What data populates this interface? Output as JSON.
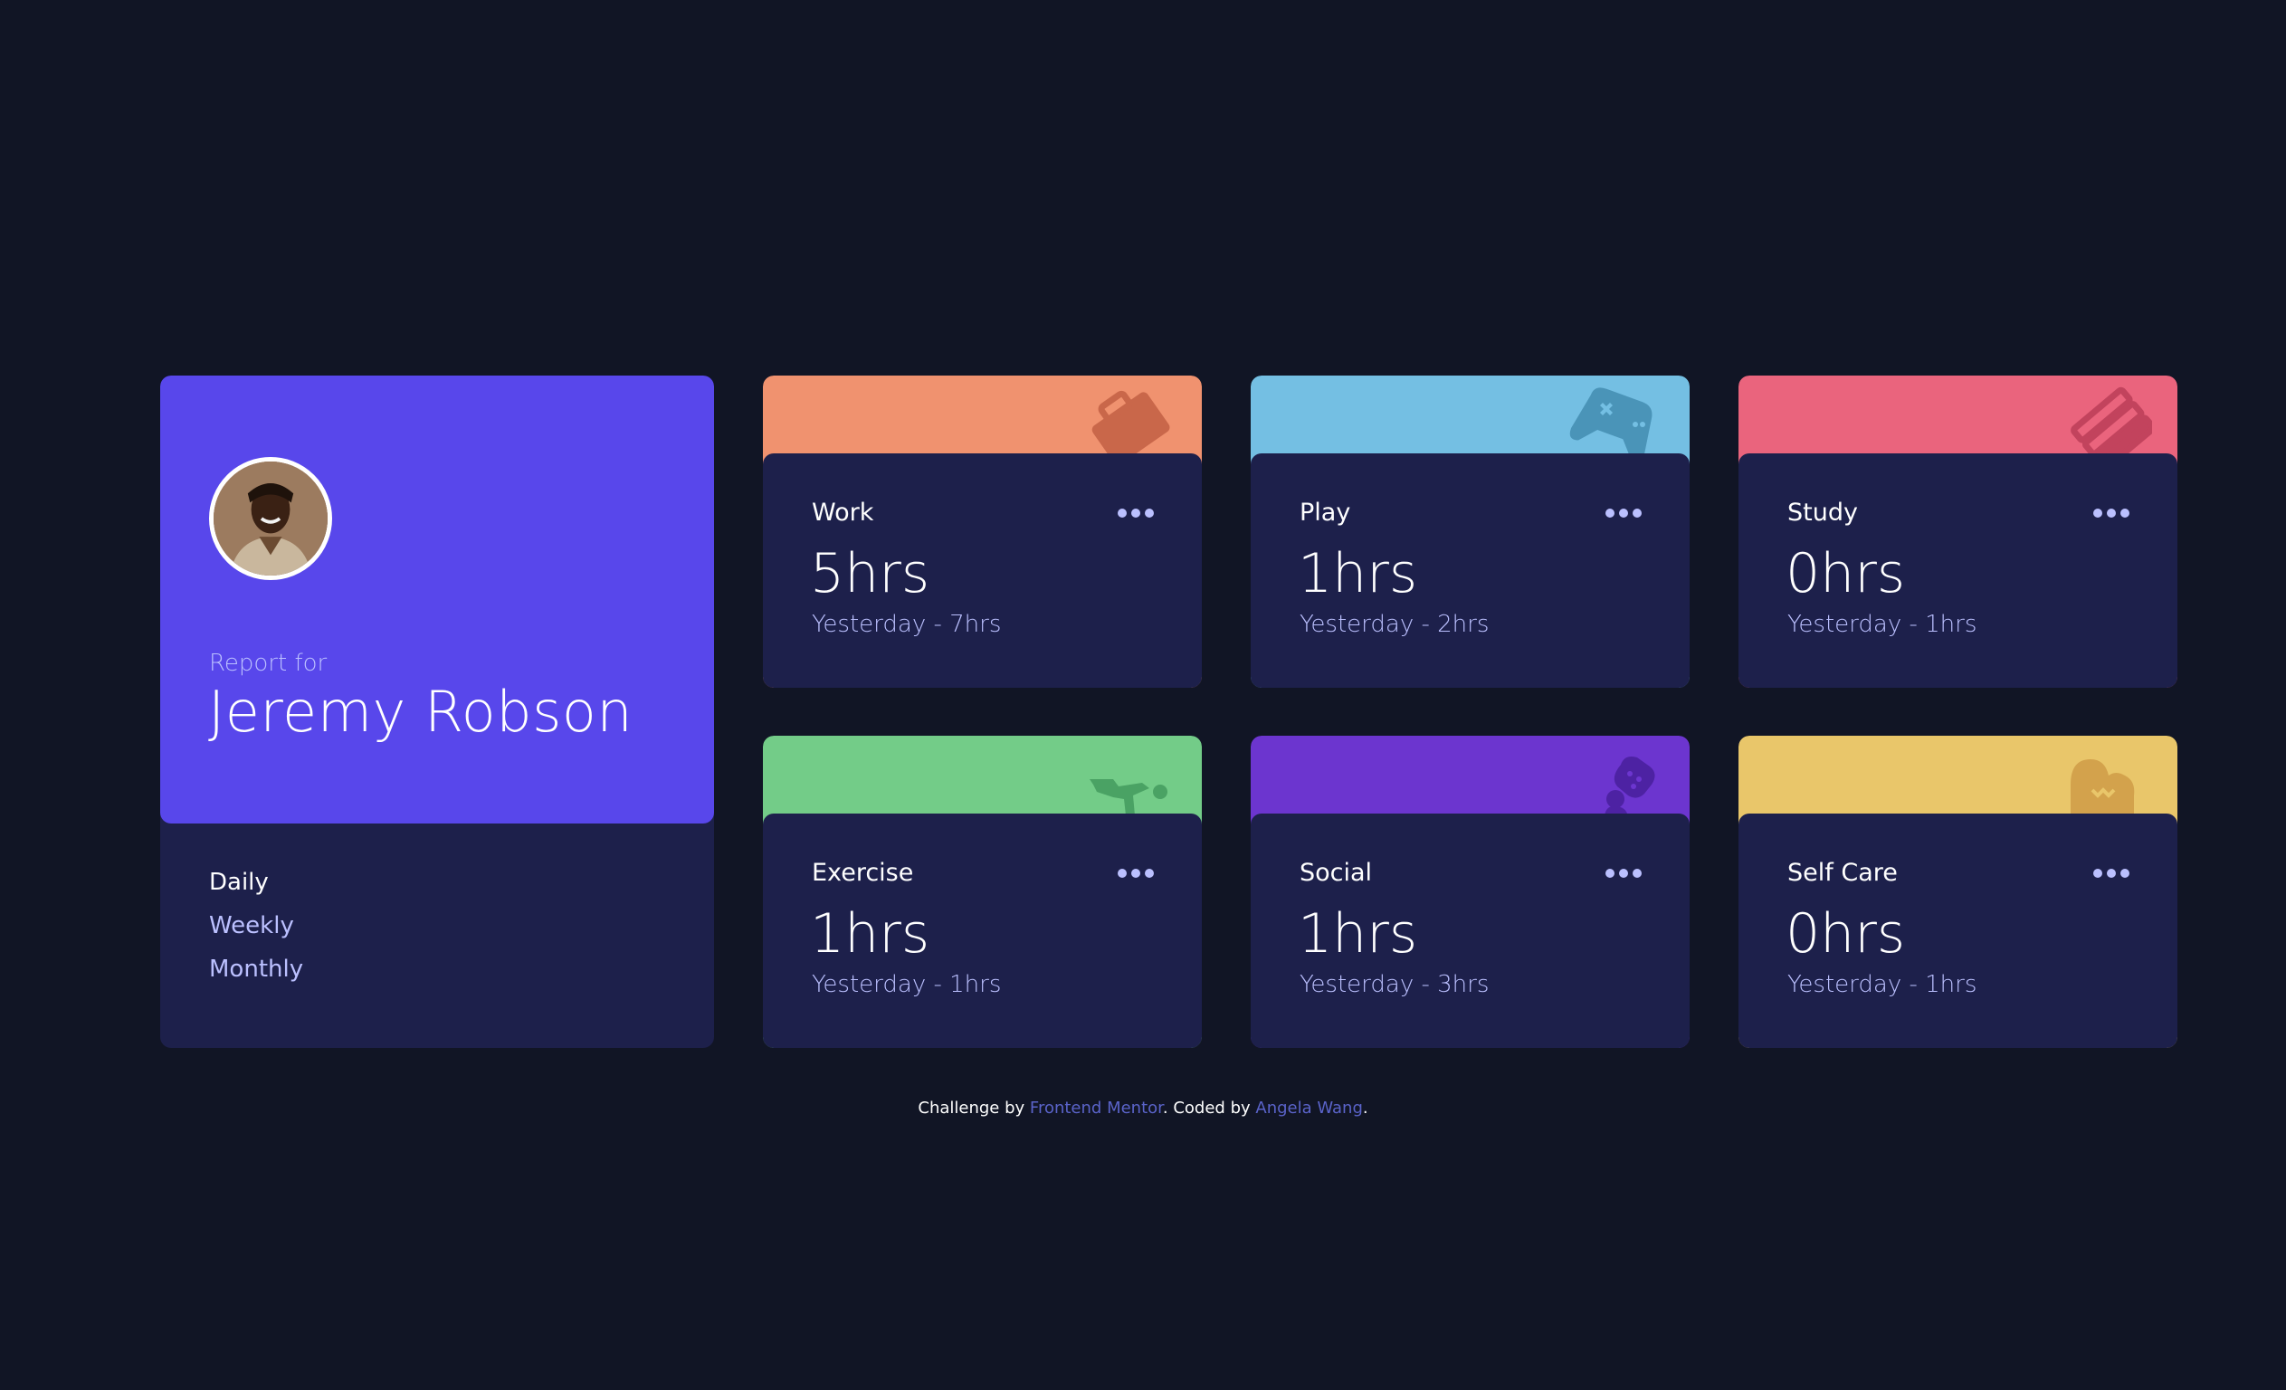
{
  "profile": {
    "report_for": "Report for",
    "name": "Jeremy Robson",
    "periods": [
      "Daily",
      "Weekly",
      "Monthly"
    ]
  },
  "cards": [
    {
      "title": "Work",
      "hours": "5hrs",
      "previous": "Yesterday - 7hrs",
      "color": "#ff8b64",
      "icon": "briefcase-icon"
    },
    {
      "title": "Play",
      "hours": "1hrs",
      "previous": "Yesterday - 2hrs",
      "color": "#55c2e6",
      "icon": "gamepad-icon"
    },
    {
      "title": "Study",
      "hours": "0hrs",
      "previous": "Yesterday - 1hrs",
      "color": "#ff5e7d",
      "icon": "books-icon"
    },
    {
      "title": "Exercise",
      "hours": "1hrs",
      "previous": "Yesterday - 1hrs",
      "color": "#4bcf82",
      "icon": "running-icon"
    },
    {
      "title": "Social",
      "hours": "1hrs",
      "previous": "Yesterday - 3hrs",
      "color": "#7335d2",
      "icon": "social-icon"
    },
    {
      "title": "Self Care",
      "hours": "0hrs",
      "previous": "Yesterday - 1hrs",
      "color": "#f1c75b",
      "icon": "heart-icon"
    }
  ],
  "footer": {
    "prefix": "Challenge by",
    "link1": "Frontend Mentor",
    "middle": ". Coded by",
    "link2": "Angela Wang",
    "suffix": "."
  },
  "colors": {
    "background": "#111525",
    "card": "#1d204b",
    "profile_accent": "#5847eb",
    "muted_text": "#bbc0ff"
  }
}
